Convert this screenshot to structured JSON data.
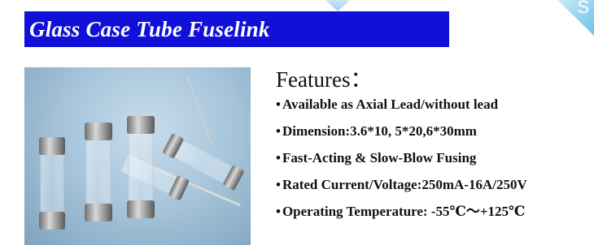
{
  "banner": {
    "title": "Glass Case Tube Fuselink",
    "corner_glyph": "S"
  },
  "photo": {
    "icon": "glass-fuse-photo"
  },
  "features": {
    "heading": "Features：",
    "bullet": "•",
    "items": [
      "Available as Axial Lead/without lead",
      "Dimension:3.6*10, 5*20,6*30mm",
      "Fast-Acting & Slow-Blow Fusing",
      "Rated Current/Voltage:250mA-16A/250V",
      "Operating Temperature: -55℃～+125℃"
    ]
  },
  "colors": {
    "banner_bg": "#1010d8",
    "banner_text": "#ffffff",
    "accent_corner": "#6cc1ea"
  }
}
